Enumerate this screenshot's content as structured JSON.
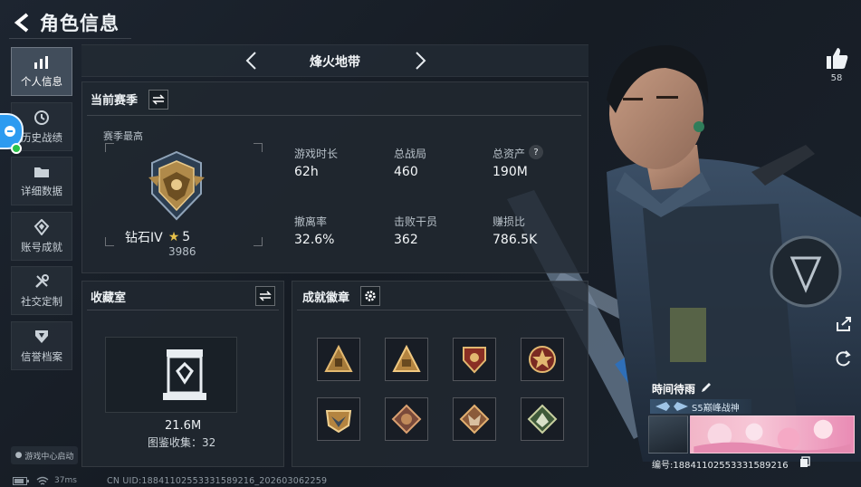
{
  "header": {
    "title": "角色信息"
  },
  "sidebar": {
    "items": [
      {
        "label": "个人信息",
        "icon": "bar-chart-icon",
        "active": true
      },
      {
        "label": "历史战绩",
        "icon": "clock-icon"
      },
      {
        "label": "详细数据",
        "icon": "folder-icon"
      },
      {
        "label": "账号成就",
        "icon": "medal-icon"
      },
      {
        "label": "社交定制",
        "icon": "tools-icon"
      },
      {
        "label": "信誉档案",
        "icon": "shield-icon"
      }
    ],
    "game_center": "游戏中心启动"
  },
  "mode": {
    "name": "烽火地带"
  },
  "season_panel": {
    "title": "当前赛季",
    "best_label": "赛季最高",
    "rank_name": "钻石IV",
    "rank_stars": "5",
    "rank_points": "3986",
    "stats": [
      {
        "label": "游戏时长",
        "value": "62h"
      },
      {
        "label": "总战局",
        "value": "460"
      },
      {
        "label": "总资产",
        "value": "190M"
      },
      {
        "label": "撤离率",
        "value": "32.6%"
      },
      {
        "label": "击败干员",
        "value": "362"
      },
      {
        "label": "赚损比",
        "value": "786.5K"
      }
    ],
    "help_glyph": "?"
  },
  "collection_panel": {
    "title": "收藏室",
    "value": "21.6M",
    "collect_label": "图鉴收集：32"
  },
  "achievement_panel": {
    "title": "成就徽章"
  },
  "profile": {
    "like_count": "58",
    "player_name": "時间待雨",
    "title_tag": "S5巅峰战神",
    "player_id": "编号:18841102553331589216"
  },
  "status": {
    "ping": "37ms",
    "uid": "CN UID:18841102553331589216_202603062259"
  },
  "colors": {
    "accent_gold": "#c9a35a",
    "panel_bg": "#212831",
    "namecard_pink": "#f2b6c8"
  }
}
